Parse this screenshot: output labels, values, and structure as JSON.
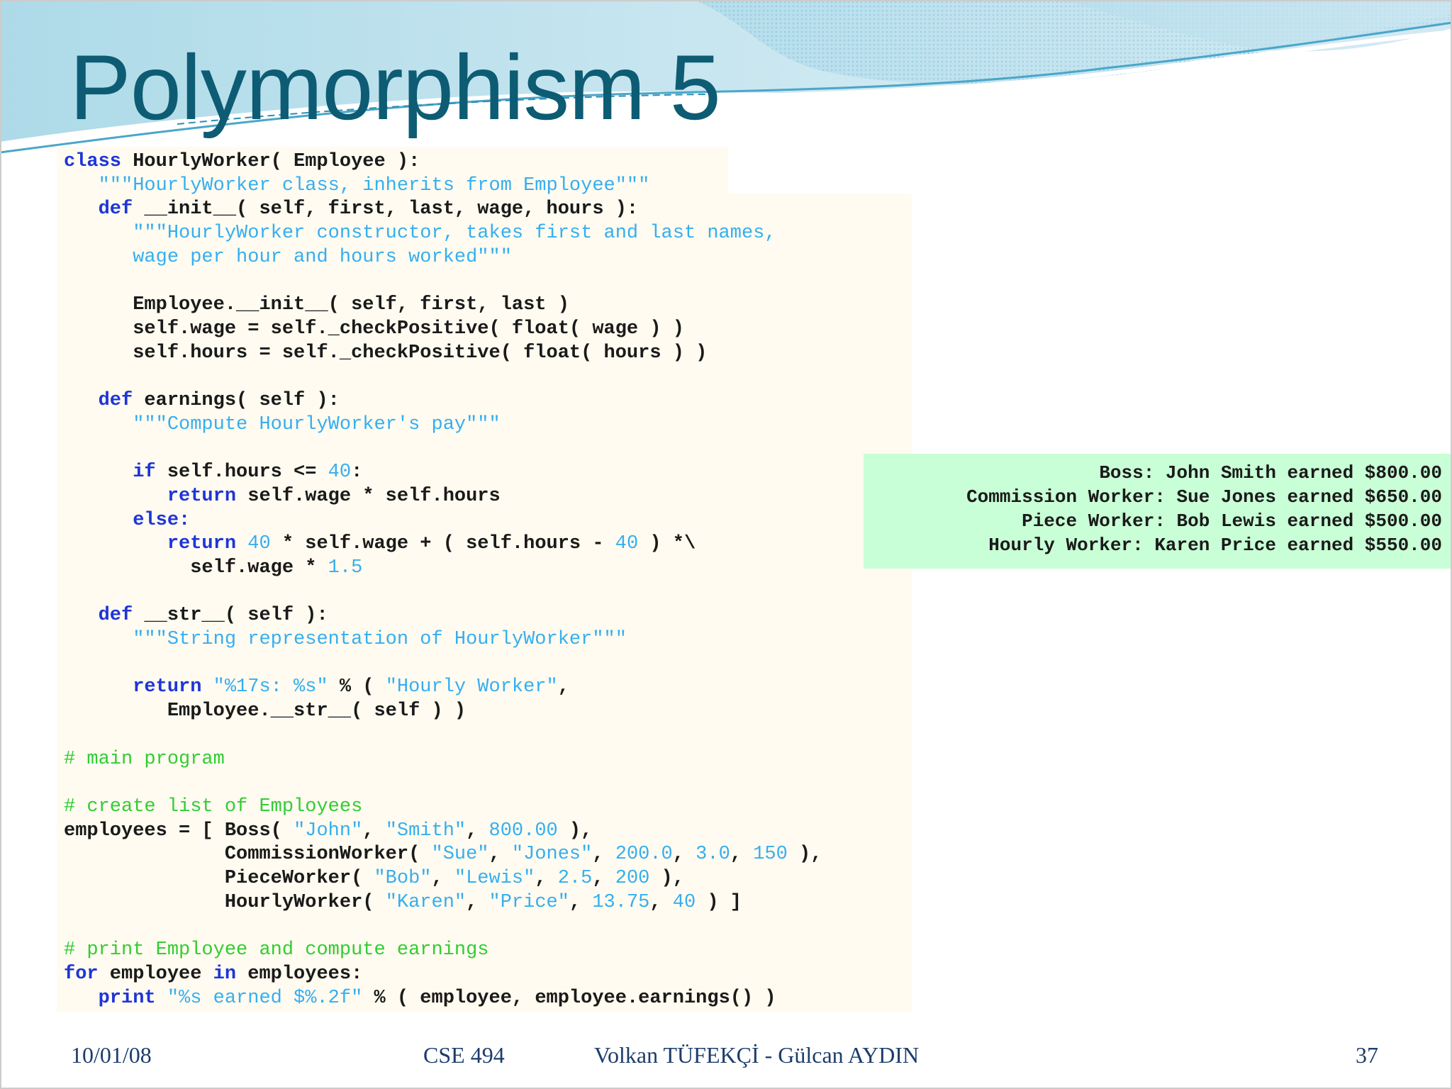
{
  "slide": {
    "title": "Polymorphism 5",
    "code": {
      "l01": [
        "class",
        " HourlyWorker( Employee ):"
      ],
      "l02": "\"\"\"HourlyWorker class, inherits from Employee\"\"\"",
      "l03": [
        "def",
        " __init__( self, first, last, wage, hours ):"
      ],
      "l04": "\"\"\"HourlyWorker constructor, takes first and last names,",
      "l05": "wage per hour and hours worked\"\"\"",
      "l07": "Employee.__init__( self, first, last )",
      "l08": "self.wage = self._checkPositive( float( wage ) )",
      "l09": "self.hours = self._checkPositive( float( hours ) )",
      "l11": [
        "def",
        " earnings( self ):"
      ],
      "l12": "\"\"\"Compute HourlyWorker's pay\"\"\"",
      "l14": [
        "if",
        " self.hours <= ",
        "40",
        ":"
      ],
      "l15": [
        "return",
        " self.wage * self.hours"
      ],
      "l16": "else:",
      "l17": [
        "return",
        " ",
        "40",
        " * self.wage + ( self.hours - ",
        "40",
        " ) *\\"
      ],
      "l18": [
        "self.wage * ",
        "1.5"
      ],
      "l20": [
        "def",
        " __str__( self ):"
      ],
      "l21": "\"\"\"String representation of HourlyWorker\"\"\"",
      "l23": [
        "return",
        " ",
        "\"%17s: %s\"",
        " % ( ",
        "\"Hourly Worker\"",
        ","
      ],
      "l24": "Employee.__str__( self ) )",
      "l26": "# main program",
      "l28": "# create list of Employees",
      "l29": [
        "employees = [ Boss( ",
        "\"John\"",
        ", ",
        "\"Smith\"",
        ", ",
        "800.00",
        " ),"
      ],
      "l30": [
        "CommissionWorker( ",
        "\"Sue\"",
        ", ",
        "\"Jones\"",
        ", ",
        "200.0",
        ", ",
        "3.0",
        ", ",
        "150",
        " ),"
      ],
      "l31": [
        "PieceWorker( ",
        "\"Bob\"",
        ", ",
        "\"Lewis\"",
        ", ",
        "2.5",
        ", ",
        "200",
        " ),"
      ],
      "l32": [
        "HourlyWorker( ",
        "\"Karen\"",
        ", ",
        "\"Price\"",
        ", ",
        "13.75",
        ", ",
        "40",
        " ) ]"
      ],
      "l34": "# print Employee and compute earnings",
      "l35": [
        "for",
        " employee ",
        "in",
        " employees:"
      ],
      "l36": [
        "print",
        " ",
        "\"%s earned $%.2f\"",
        " % ( employee, employee.earnings() )"
      ]
    },
    "output_lines": [
      "Boss: John Smith earned $800.00",
      "Commission Worker: Sue Jones earned $650.00",
      "Piece Worker: Bob Lewis earned $500.00",
      "Hourly Worker: Karen Price earned $550.00"
    ],
    "footer": {
      "date": "10/01/08",
      "course": "CSE 494",
      "authors": "Volkan TÜFEKÇİ - Gülcan AYDIN",
      "page": "37"
    }
  },
  "colors": {
    "title": "#0d5c73",
    "code_background": "#fffbf0",
    "output_background": "#c9ffd6",
    "keyword": "#1e35d8",
    "string": "#36aef0",
    "comment": "#33cc33"
  }
}
